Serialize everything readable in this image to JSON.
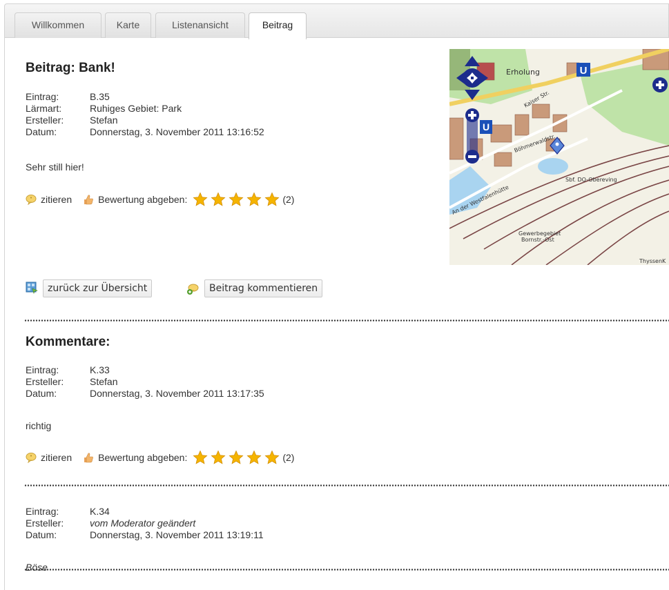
{
  "tabs": [
    {
      "label": "Willkommen",
      "active": false
    },
    {
      "label": "Karte",
      "active": false
    },
    {
      "label": "Listenansicht",
      "active": false
    },
    {
      "label": "Beitrag",
      "active": true
    }
  ],
  "post": {
    "title": "Beitrag: Bank!",
    "meta": [
      {
        "key": "Eintrag:",
        "value": "B.35"
      },
      {
        "key": "Lärmart:",
        "value": "Ruhiges Gebiet: Park"
      },
      {
        "key": "Ersteller:",
        "value": "Stefan"
      },
      {
        "key": "Datum:",
        "value": "Donnerstag, 3. November 2011 13:16:52"
      }
    ],
    "text": "Sehr still hier!",
    "cite_label": "zitieren",
    "rate_label": "Bewertung abgeben:",
    "rating": 5,
    "rating_count": "(2)"
  },
  "map": {
    "labels": {
      "erholung": "Erholung",
      "sbf": "Sbf. DO-Obereving",
      "gewerbe1": "Gewerbegebiet",
      "gewerbe2": "Bornstr.-Ost",
      "thyssen": "ThyssenK",
      "boehmer": "Böhmerwaldstr.",
      "westfalen": "An der Westfalenhütte",
      "kaiser": "Kaiser Str."
    }
  },
  "buttons": {
    "back": "zurück zur Übersicht",
    "comment": "Beitrag kommentieren"
  },
  "comments_heading": "Kommentare:",
  "comments": [
    {
      "meta": [
        {
          "key": "Eintrag:",
          "value": "K.33"
        },
        {
          "key": "Ersteller:",
          "value": "Stefan"
        },
        {
          "key": "Datum:",
          "value": "Donnerstag, 3. November 2011 13:17:35"
        }
      ],
      "text": "richtig",
      "cite_label": "zitieren",
      "rate_label": "Bewertung abgeben:",
      "rating": 5,
      "rating_count": "(2)"
    },
    {
      "meta": [
        {
          "key": "Eintrag:",
          "value": "K.34"
        },
        {
          "key": "Ersteller:",
          "value": "vom Moderator geändert"
        },
        {
          "key": "Datum:",
          "value": "Donnerstag, 3. November 2011 13:19:11"
        }
      ],
      "text": "Böse"
    }
  ],
  "colors": {
    "star": "#f5b400",
    "nav_control": "#1c2c8c",
    "map_water": "#a9d4f0",
    "map_green": "#bfe3a8"
  }
}
